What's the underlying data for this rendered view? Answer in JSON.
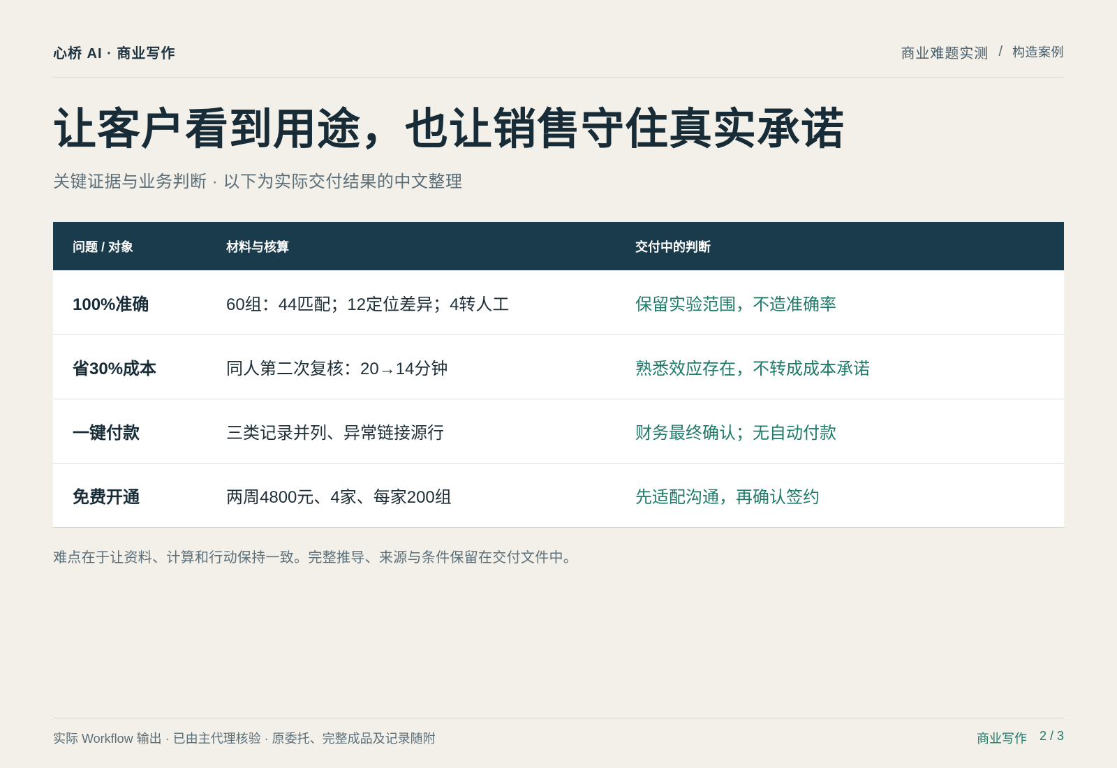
{
  "header": {
    "brand": "心桥 AI · 商业写作",
    "section": "商业难题实测",
    "separator": "/",
    "case": "构造案例"
  },
  "title": "让客户看到用途，也让销售守住真实承诺",
  "subtitle": "关键证据与业务判断 · 以下为实际交付结果的中文整理",
  "table": {
    "headers": [
      "问题 / 对象",
      "材料与核算",
      "交付中的判断"
    ],
    "rows": [
      {
        "issue": "100%准确",
        "material": "60组：44匹配；12定位差异；4转人工",
        "judgment": "保留实验范围，不造准确率"
      },
      {
        "issue": "省30%成本",
        "material": "同人第二次复核：20→14分钟",
        "judgment": "熟悉效应存在，不转成成本承诺"
      },
      {
        "issue": "一键付款",
        "material": "三类记录并列、异常链接源行",
        "judgment": "财务最终确认；无自动付款"
      },
      {
        "issue": "免费开通",
        "material": "两周4800元、4家、每家200组",
        "judgment": "先适配沟通，再确认签约"
      }
    ]
  },
  "note": "难点在于让资料、计算和行动保持一致。完整推导、来源与条件保留在交付文件中。",
  "footer": {
    "left": "实际 Workflow 输出 · 已由主代理核验 · 原委托、完整成品及记录随附",
    "category": "商业写作",
    "page": "2 / 3"
  },
  "colors": {
    "background": "#f3f0ea",
    "header_bg": "#193b4b",
    "accent_green": "#1f7a6a",
    "title_text": "#172c37"
  }
}
